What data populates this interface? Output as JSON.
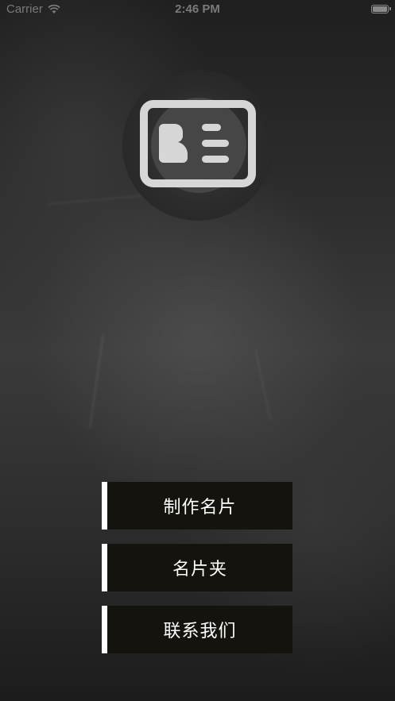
{
  "status_bar": {
    "carrier": "Carrier",
    "time": "2:46 PM"
  },
  "logo": {
    "icon": "business-card-icon"
  },
  "menu": {
    "items": [
      {
        "label": "制作名片"
      },
      {
        "label": "名片夹"
      },
      {
        "label": "联系我们"
      }
    ]
  },
  "colors": {
    "button_bg": "#14130d",
    "button_accent": "#ffffff",
    "icon": "#e0e0e0"
  }
}
